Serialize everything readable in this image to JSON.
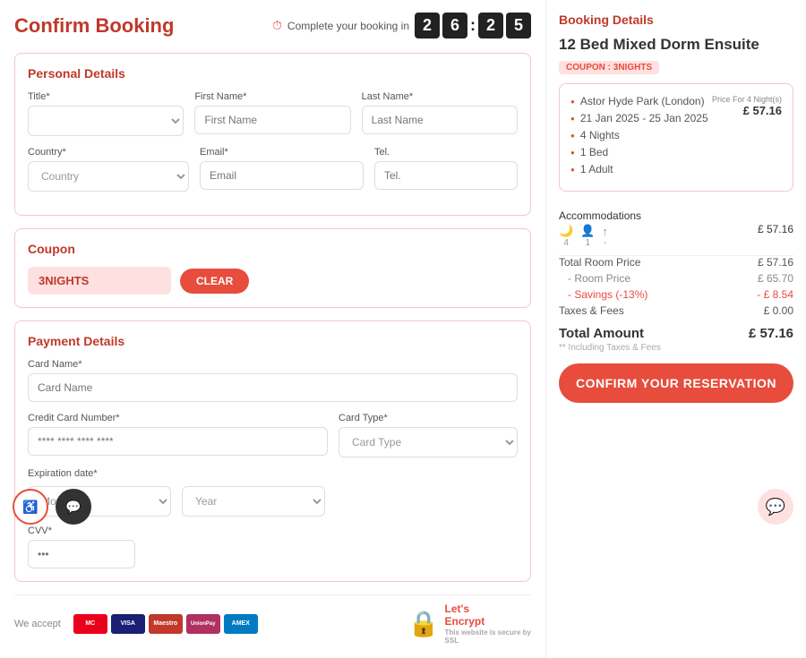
{
  "page": {
    "title": "Confirm Booking",
    "timer": {
      "label": "Complete your booking in",
      "digits": [
        "2",
        "6",
        "2",
        "5"
      ]
    }
  },
  "personal_details": {
    "section_title": "Personal Details",
    "title_label": "Title*",
    "first_name_label": "First Name*",
    "first_name_placeholder": "First Name",
    "last_name_label": "Last Name*",
    "last_name_placeholder": "Last Name",
    "country_label": "Country*",
    "country_placeholder": "Country",
    "email_label": "Email*",
    "email_placeholder": "Email",
    "tel_label": "Tel.",
    "tel_placeholder": "Tel."
  },
  "coupon": {
    "section_title": "Coupon",
    "value": "3NIGHTS",
    "clear_label": "CLEAR"
  },
  "payment": {
    "section_title": "Payment Details",
    "card_name_label": "Card Name*",
    "card_name_placeholder": "Card Name",
    "card_number_label": "Credit Card Number*",
    "card_number_placeholder": "**** **** **** ****",
    "card_type_label": "Card Type*",
    "card_type_placeholder": "Card Type",
    "expiry_label": "Expiration date*",
    "month_placeholder": "Month",
    "year_placeholder": "Year",
    "cvv_label": "CVV*"
  },
  "footer": {
    "we_accept": "We accept"
  },
  "booking_details": {
    "section_title": "Booking Details",
    "property_name": "12 Bed Mixed Dorm Ensuite",
    "coupon_code": "COUPON : 3NIGHTS",
    "details": [
      "Astor Hyde Park (London)",
      "21 Jan 2025 - 25 Jan 2025",
      "4 Nights",
      "1 Bed",
      "1 Adult"
    ],
    "price_for_label": "Price For 4 Night(s)",
    "price_for_value": "£ 57.16",
    "accommodations_label": "Accommodations",
    "accommodations_price": "£ 57.16",
    "total_room_price_label": "Total Room Price",
    "total_room_price_value": "£ 57.16",
    "room_price_label": "- Room Price",
    "room_price_value": "£ 65.70",
    "savings_label": "- Savings (-13%)",
    "savings_value": "- £ 8.54",
    "taxes_label": "Taxes & Fees",
    "taxes_value": "£ 0.00",
    "total_amount_label": "Total Amount",
    "total_amount_value": "£ 57.16",
    "total_note": "** Including Taxes & Fees",
    "confirm_btn": "CONFIRM YOUR RESERVATION"
  }
}
